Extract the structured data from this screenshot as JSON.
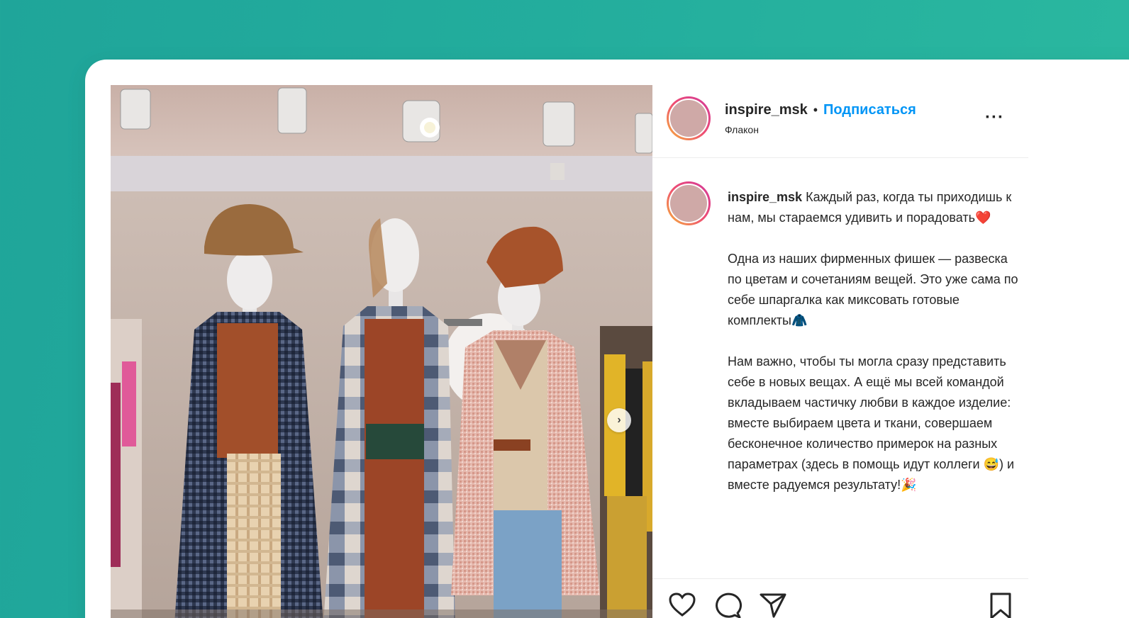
{
  "post": {
    "username": "inspire_msk",
    "separator": "•",
    "follow_label": "Подписаться",
    "location": "Флакон",
    "more_label": "···",
    "caption": {
      "username": "inspire_msk",
      "paragraph1": "Каждый раз, когда ты приходишь к нам, мы стараемся удивить и порадовать❤️",
      "paragraph2": "Одна из наших фирменных фишек — развеска по цветам и сочетаниям вещей. Это уже сама по себе шпаргалка как миксовать готовые комплекты🧥",
      "paragraph3": "Нам важно, чтобы ты могла сразу представить себе в новых вещах. А ещё мы всей командой вкладываем частичку любви в каждое изделие: вместе выбираем цвета и ткани, совершаем бесконечное количество примерок на разных параметрах (здесь в помощь идут коллеги 😅) и вместе радуемся результату!🎉"
    }
  },
  "colors": {
    "background": "#23ad9d",
    "accent": "#0095f6",
    "text": "#262626"
  },
  "icons": {
    "like": "heart-icon",
    "comment": "comment-icon",
    "share": "paper-plane-icon",
    "save": "bookmark-icon",
    "carousel_next": "chevron-right-icon"
  }
}
